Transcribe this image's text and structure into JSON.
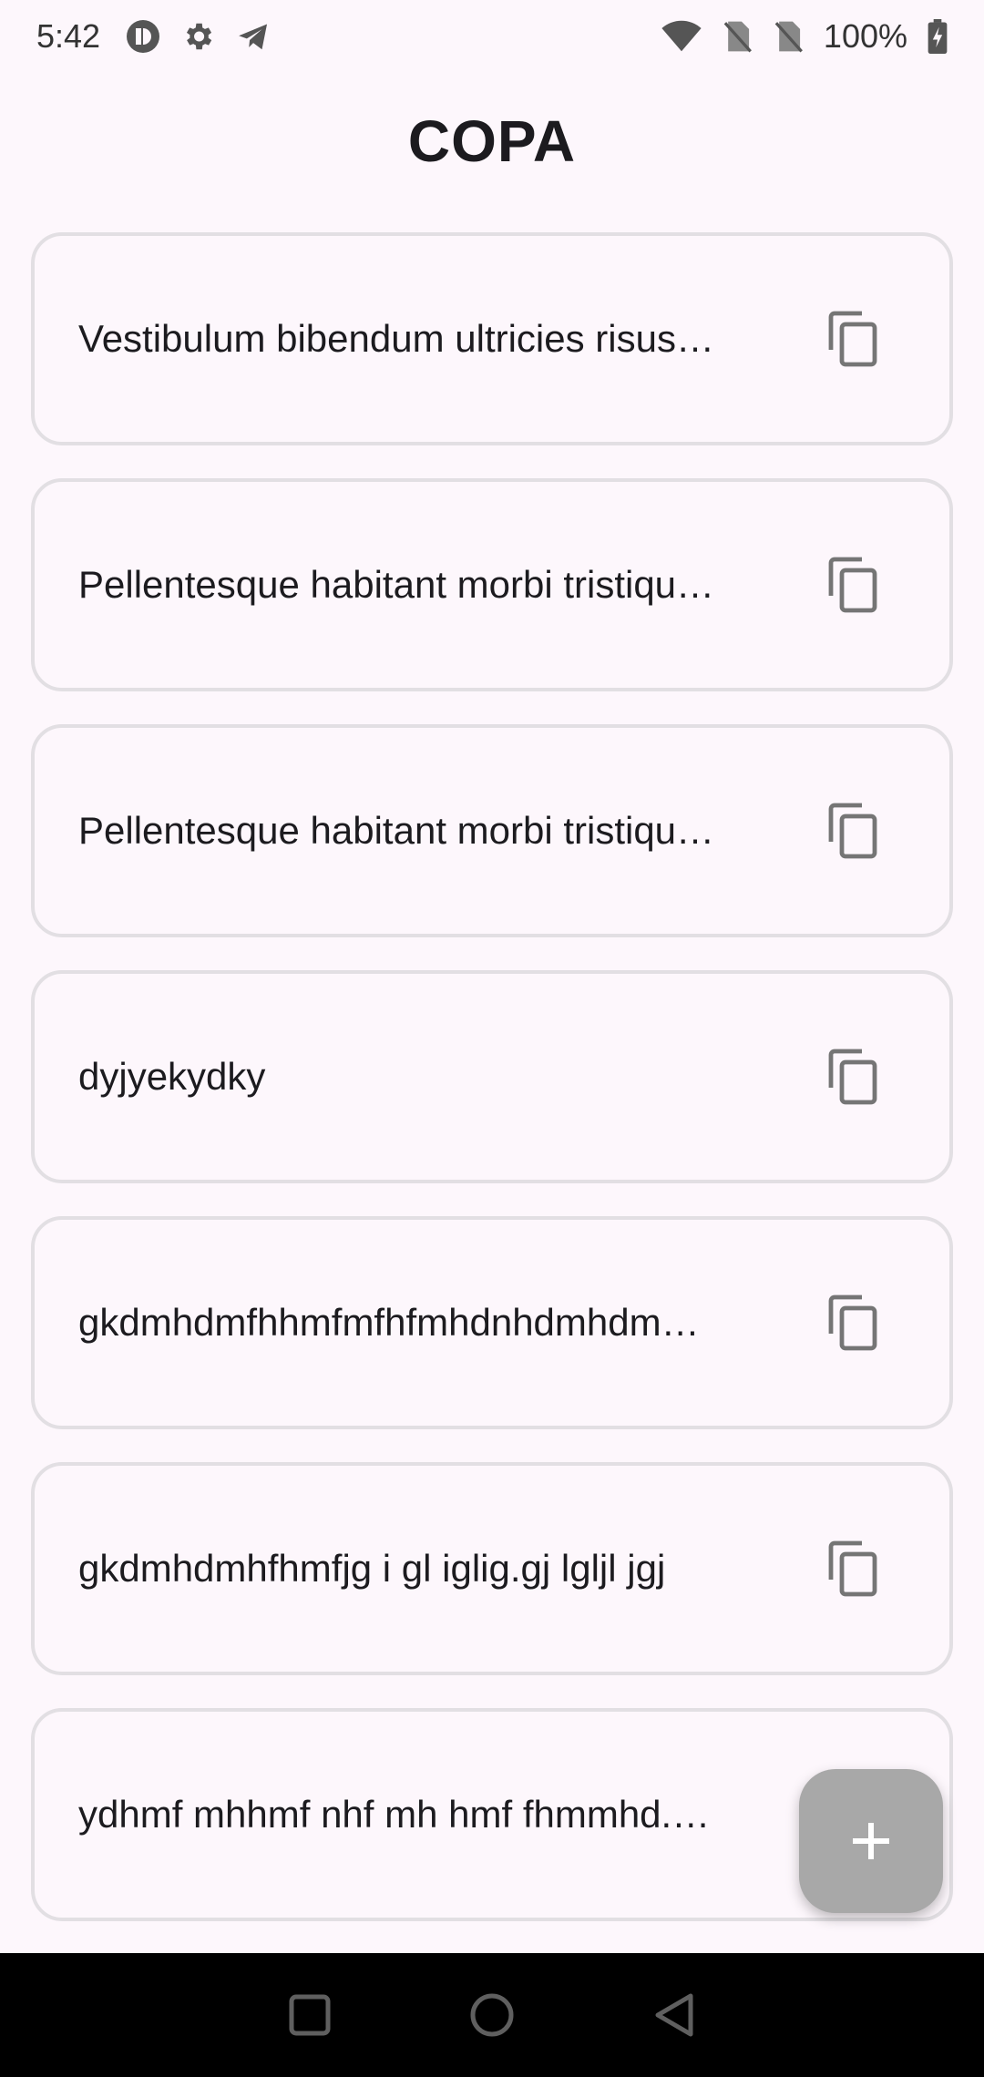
{
  "status_bar": {
    "time": "5:42",
    "battery_percent": "100%",
    "icons": [
      "record-icon",
      "settings-icon",
      "telegram-icon",
      "wifi-icon",
      "no-sim-icon",
      "no-sim-icon",
      "battery-charging-icon"
    ]
  },
  "app": {
    "title": "COPA"
  },
  "items": [
    {
      "text": "Vestibulum bibendum ultricies risus…"
    },
    {
      "text": "Pellentesque habitant morbi tristiqu…"
    },
    {
      "text": "Pellentesque habitant morbi tristiqu…"
    },
    {
      "text": "dyjyekydky"
    },
    {
      "text": "gkdmhdmfhhmfmfhfmhdnhdmhdm…"
    },
    {
      "text": "gkdmhdmhfhmfjg i gl iglig.gj lgljl jgj"
    },
    {
      "text": "ydhmf mhhmf nhf mh hmf fhmmhd.…"
    }
  ],
  "fab": {
    "icon": "plus-icon"
  },
  "colors": {
    "background": "#fdf7fc",
    "card_border": "#e2dfe3",
    "fab": "#a8a8a8",
    "nav_bar": "#000000"
  }
}
